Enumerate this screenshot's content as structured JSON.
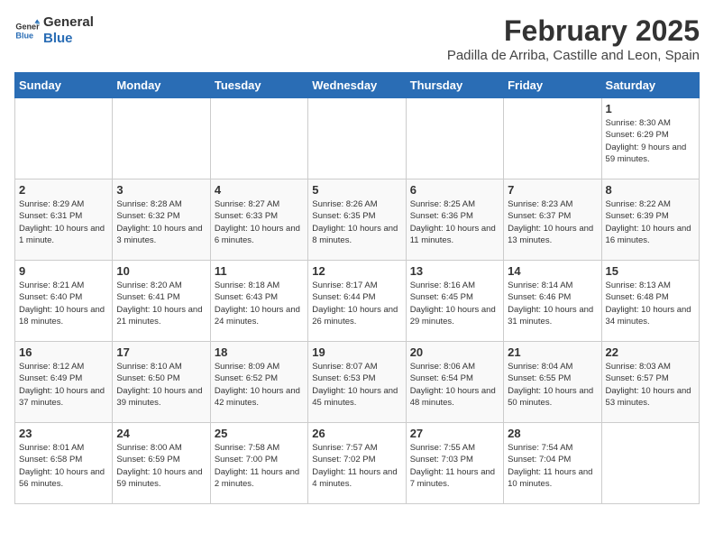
{
  "logo": {
    "line1": "General",
    "line2": "Blue"
  },
  "title": "February 2025",
  "subtitle": "Padilla de Arriba, Castille and Leon, Spain",
  "days_of_week": [
    "Sunday",
    "Monday",
    "Tuesday",
    "Wednesday",
    "Thursday",
    "Friday",
    "Saturday"
  ],
  "weeks": [
    [
      {
        "day": "",
        "info": ""
      },
      {
        "day": "",
        "info": ""
      },
      {
        "day": "",
        "info": ""
      },
      {
        "day": "",
        "info": ""
      },
      {
        "day": "",
        "info": ""
      },
      {
        "day": "",
        "info": ""
      },
      {
        "day": "1",
        "info": "Sunrise: 8:30 AM\nSunset: 6:29 PM\nDaylight: 9 hours and 59 minutes."
      }
    ],
    [
      {
        "day": "2",
        "info": "Sunrise: 8:29 AM\nSunset: 6:31 PM\nDaylight: 10 hours and 1 minute."
      },
      {
        "day": "3",
        "info": "Sunrise: 8:28 AM\nSunset: 6:32 PM\nDaylight: 10 hours and 3 minutes."
      },
      {
        "day": "4",
        "info": "Sunrise: 8:27 AM\nSunset: 6:33 PM\nDaylight: 10 hours and 6 minutes."
      },
      {
        "day": "5",
        "info": "Sunrise: 8:26 AM\nSunset: 6:35 PM\nDaylight: 10 hours and 8 minutes."
      },
      {
        "day": "6",
        "info": "Sunrise: 8:25 AM\nSunset: 6:36 PM\nDaylight: 10 hours and 11 minutes."
      },
      {
        "day": "7",
        "info": "Sunrise: 8:23 AM\nSunset: 6:37 PM\nDaylight: 10 hours and 13 minutes."
      },
      {
        "day": "8",
        "info": "Sunrise: 8:22 AM\nSunset: 6:39 PM\nDaylight: 10 hours and 16 minutes."
      }
    ],
    [
      {
        "day": "9",
        "info": "Sunrise: 8:21 AM\nSunset: 6:40 PM\nDaylight: 10 hours and 18 minutes."
      },
      {
        "day": "10",
        "info": "Sunrise: 8:20 AM\nSunset: 6:41 PM\nDaylight: 10 hours and 21 minutes."
      },
      {
        "day": "11",
        "info": "Sunrise: 8:18 AM\nSunset: 6:43 PM\nDaylight: 10 hours and 24 minutes."
      },
      {
        "day": "12",
        "info": "Sunrise: 8:17 AM\nSunset: 6:44 PM\nDaylight: 10 hours and 26 minutes."
      },
      {
        "day": "13",
        "info": "Sunrise: 8:16 AM\nSunset: 6:45 PM\nDaylight: 10 hours and 29 minutes."
      },
      {
        "day": "14",
        "info": "Sunrise: 8:14 AM\nSunset: 6:46 PM\nDaylight: 10 hours and 31 minutes."
      },
      {
        "day": "15",
        "info": "Sunrise: 8:13 AM\nSunset: 6:48 PM\nDaylight: 10 hours and 34 minutes."
      }
    ],
    [
      {
        "day": "16",
        "info": "Sunrise: 8:12 AM\nSunset: 6:49 PM\nDaylight: 10 hours and 37 minutes."
      },
      {
        "day": "17",
        "info": "Sunrise: 8:10 AM\nSunset: 6:50 PM\nDaylight: 10 hours and 39 minutes."
      },
      {
        "day": "18",
        "info": "Sunrise: 8:09 AM\nSunset: 6:52 PM\nDaylight: 10 hours and 42 minutes."
      },
      {
        "day": "19",
        "info": "Sunrise: 8:07 AM\nSunset: 6:53 PM\nDaylight: 10 hours and 45 minutes."
      },
      {
        "day": "20",
        "info": "Sunrise: 8:06 AM\nSunset: 6:54 PM\nDaylight: 10 hours and 48 minutes."
      },
      {
        "day": "21",
        "info": "Sunrise: 8:04 AM\nSunset: 6:55 PM\nDaylight: 10 hours and 50 minutes."
      },
      {
        "day": "22",
        "info": "Sunrise: 8:03 AM\nSunset: 6:57 PM\nDaylight: 10 hours and 53 minutes."
      }
    ],
    [
      {
        "day": "23",
        "info": "Sunrise: 8:01 AM\nSunset: 6:58 PM\nDaylight: 10 hours and 56 minutes."
      },
      {
        "day": "24",
        "info": "Sunrise: 8:00 AM\nSunset: 6:59 PM\nDaylight: 10 hours and 59 minutes."
      },
      {
        "day": "25",
        "info": "Sunrise: 7:58 AM\nSunset: 7:00 PM\nDaylight: 11 hours and 2 minutes."
      },
      {
        "day": "26",
        "info": "Sunrise: 7:57 AM\nSunset: 7:02 PM\nDaylight: 11 hours and 4 minutes."
      },
      {
        "day": "27",
        "info": "Sunrise: 7:55 AM\nSunset: 7:03 PM\nDaylight: 11 hours and 7 minutes."
      },
      {
        "day": "28",
        "info": "Sunrise: 7:54 AM\nSunset: 7:04 PM\nDaylight: 11 hours and 10 minutes."
      },
      {
        "day": "",
        "info": ""
      }
    ]
  ]
}
